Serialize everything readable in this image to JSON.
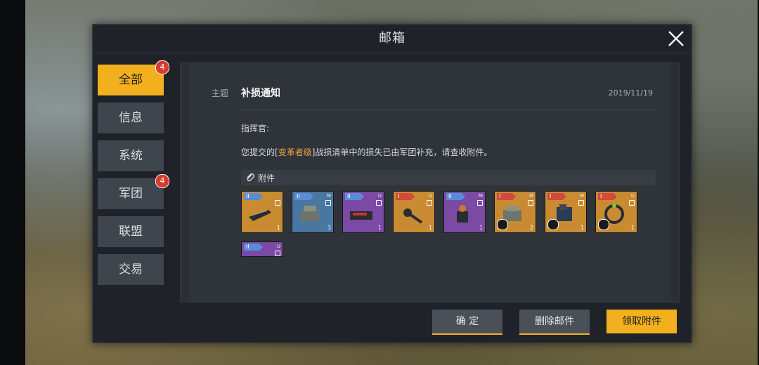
{
  "window": {
    "title": "邮箱"
  },
  "tabs": [
    {
      "label": "全部",
      "badge": "4"
    },
    {
      "label": "信息"
    },
    {
      "label": "系统"
    },
    {
      "label": "军团",
      "badge": "4"
    },
    {
      "label": "联盟"
    },
    {
      "label": "交易"
    }
  ],
  "mail": {
    "subject_label": "主题",
    "subject": "补损通知",
    "date": "2019/11/19",
    "greeting": "指挥官:",
    "body_prefix": "您提交的[",
    "body_highlight": "变革者级",
    "body_suffix": "]战损清单中的损失已由军团补充，请查收附件。",
    "attachments_label": "附件"
  },
  "attachments": [
    {
      "tier": "II",
      "tag_color": "blue",
      "bg": "orange",
      "class": "",
      "qty": "1"
    },
    {
      "tier": "II",
      "tag_color": "blue",
      "bg": "blue",
      "class": "M",
      "qty": "3"
    },
    {
      "tier": "II",
      "tag_color": "blue",
      "bg": "purple",
      "class": "U",
      "qty": "1"
    },
    {
      "tier": "I",
      "tag_color": "red",
      "bg": "orange",
      "class": "U",
      "qty": "1"
    },
    {
      "tier": "II",
      "tag_color": "blue",
      "bg": "purple",
      "class": "M",
      "qty": "1"
    },
    {
      "tier": "I",
      "tag_color": "red",
      "bg": "orange",
      "class": "M",
      "qty": "2"
    },
    {
      "tier": "I",
      "tag_color": "red",
      "bg": "orange",
      "class": "M",
      "qty": "1"
    },
    {
      "tier": "I",
      "tag_color": "red",
      "bg": "orange",
      "class": "U",
      "qty": "1"
    },
    {
      "tier": "II",
      "tag_color": "blue",
      "bg": "purple",
      "class": "U",
      "qty": ""
    }
  ],
  "buttons": {
    "confirm": "确 定",
    "delete": "删除邮件",
    "claim": "领取附件"
  },
  "colors": {
    "accent": "#f2b01e",
    "badge": "#d93a2f",
    "highlight": "#e9a53b"
  }
}
